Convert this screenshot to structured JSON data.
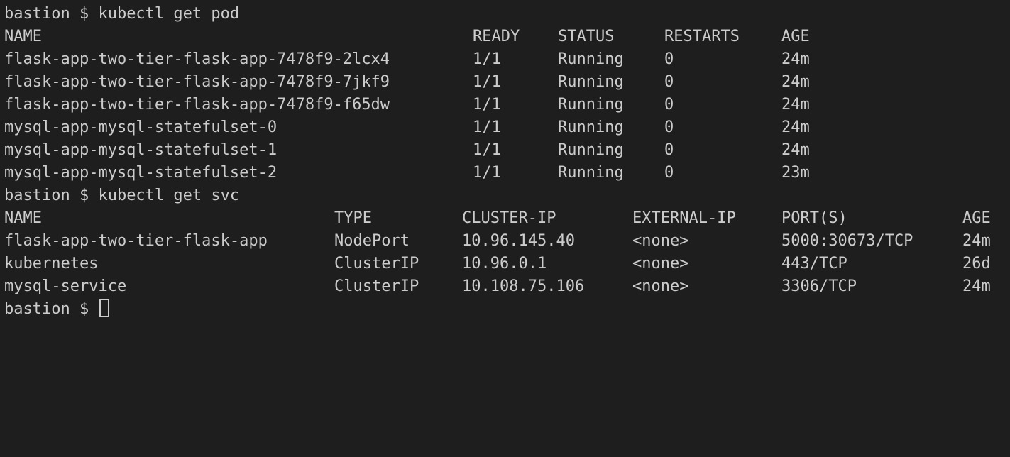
{
  "prompt": "bastion $ ",
  "commands": {
    "get_pod": "kubectl get pod",
    "get_svc": "kubectl get svc"
  },
  "pods": {
    "headers": [
      "NAME",
      "READY",
      "STATUS",
      "RESTARTS",
      "AGE"
    ],
    "rows": [
      [
        "flask-app-two-tier-flask-app-7478f9-2lcx4",
        "1/1",
        "Running",
        "0",
        "24m"
      ],
      [
        "flask-app-two-tier-flask-app-7478f9-7jkf9",
        "1/1",
        "Running",
        "0",
        "24m"
      ],
      [
        "flask-app-two-tier-flask-app-7478f9-f65dw",
        "1/1",
        "Running",
        "0",
        "24m"
      ],
      [
        "mysql-app-mysql-statefulset-0",
        "1/1",
        "Running",
        "0",
        "24m"
      ],
      [
        "mysql-app-mysql-statefulset-1",
        "1/1",
        "Running",
        "0",
        "24m"
      ],
      [
        "mysql-app-mysql-statefulset-2",
        "1/1",
        "Running",
        "0",
        "23m"
      ]
    ]
  },
  "services": {
    "headers": [
      "NAME",
      "TYPE",
      "CLUSTER-IP",
      "EXTERNAL-IP",
      "PORT(S)",
      "AGE"
    ],
    "rows": [
      [
        "flask-app-two-tier-flask-app",
        "NodePort",
        "10.96.145.40",
        "<none>",
        "5000:30673/TCP",
        "24m"
      ],
      [
        "kubernetes",
        "ClusterIP",
        "10.96.0.1",
        "<none>",
        "443/TCP",
        "26d"
      ],
      [
        "mysql-service",
        "ClusterIP",
        "10.108.75.106",
        "<none>",
        "3306/TCP",
        "24m"
      ]
    ]
  },
  "colors": {
    "background": "#1e1e1e",
    "foreground": "#cccccc"
  }
}
